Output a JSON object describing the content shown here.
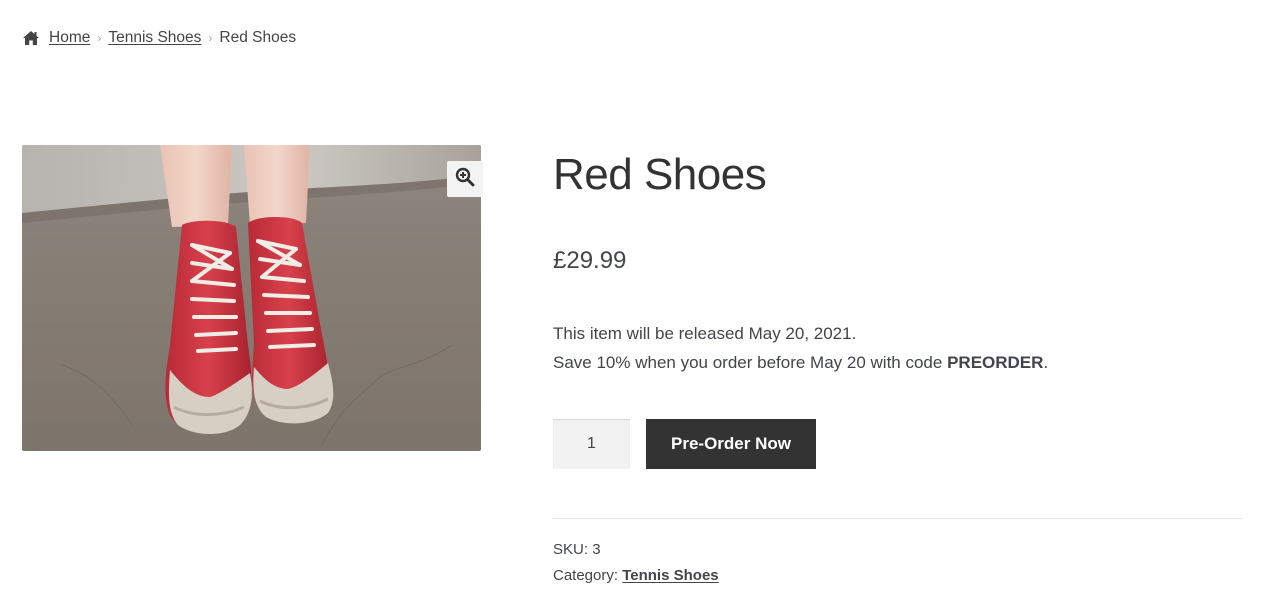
{
  "breadcrumb": {
    "home_icon": "home-icon",
    "items": [
      {
        "label": "Home"
      },
      {
        "label": "Tennis Shoes"
      }
    ],
    "current": "Red Shoes"
  },
  "gallery": {
    "image_alt": "Red Shoes",
    "zoom_icon": "zoom-in-icon"
  },
  "product": {
    "title": "Red Shoes",
    "price": "£29.99",
    "description": {
      "line1": "This item will be released May 20, 2021.",
      "line2_prefix": "Save 10% when you order before May 20 with code ",
      "line2_code": "PREORDER",
      "line2_suffix": "."
    },
    "quantity": "1",
    "button_label": "Pre-Order Now",
    "meta": {
      "sku_label": "SKU:",
      "sku_value": "3",
      "category_label": "Category:",
      "category_value": "Tennis Shoes"
    }
  },
  "colors": {
    "text": "#43454b",
    "title": "#333333",
    "button_bg": "#333333",
    "button_text": "#ffffff",
    "qty_bg": "#f2f2f2",
    "zoom_bg": "#f3f3f3"
  }
}
